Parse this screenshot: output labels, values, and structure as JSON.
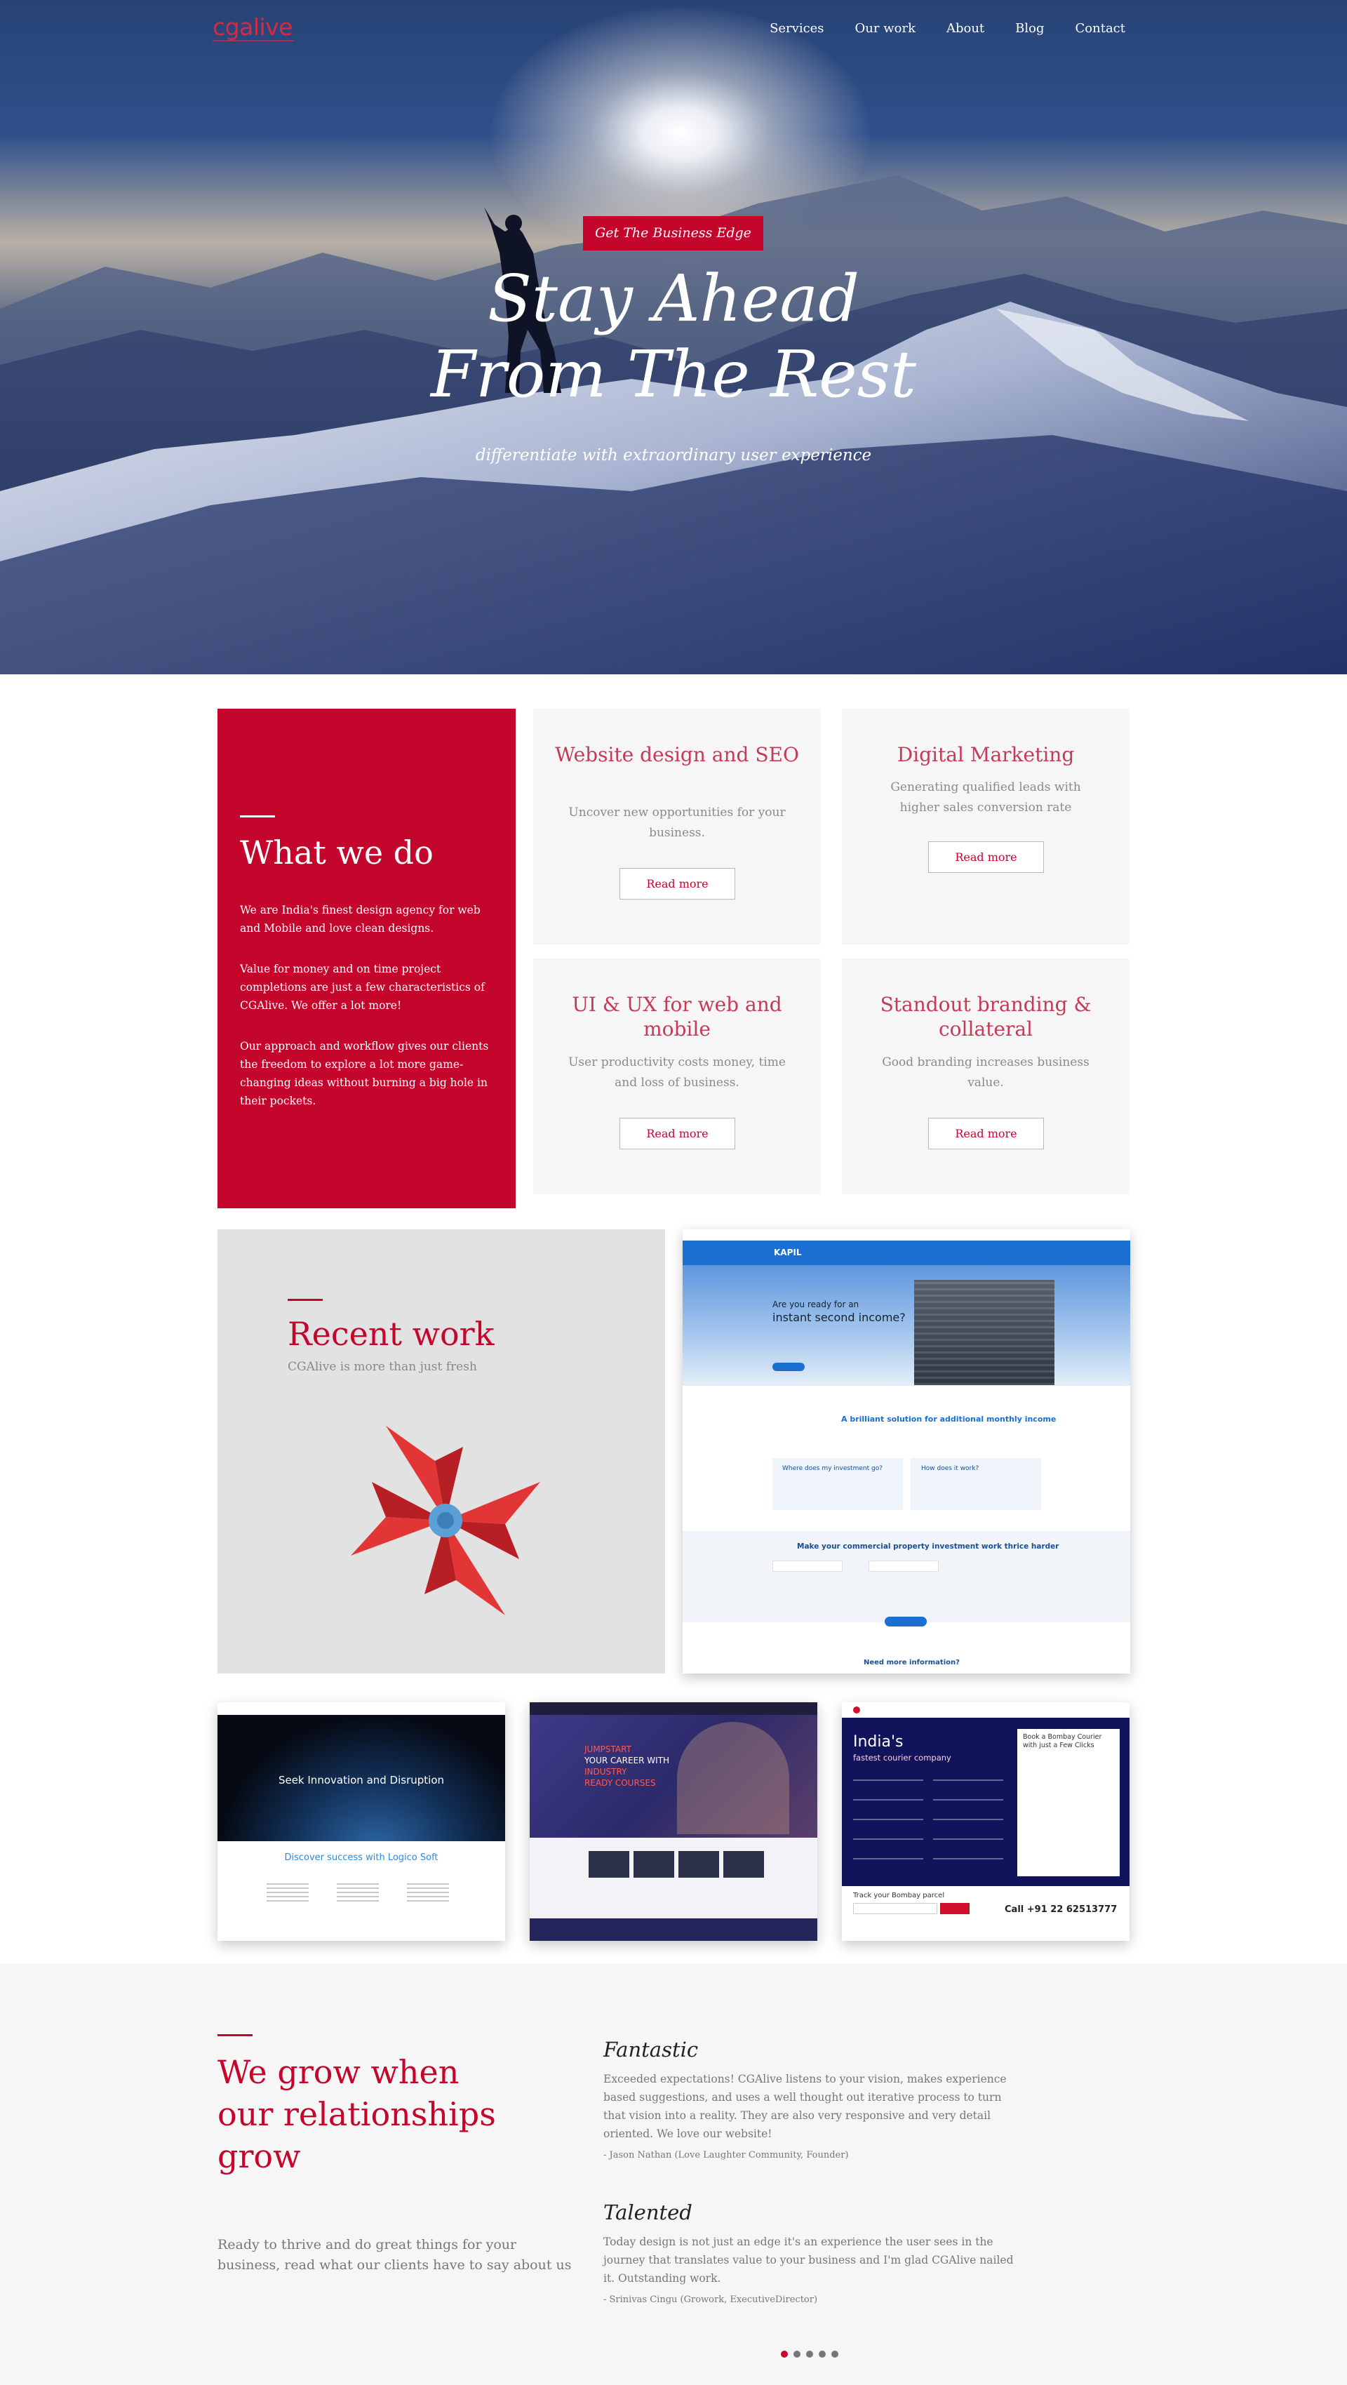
{
  "header": {
    "logo": "cgalive",
    "nav": [
      "Services",
      "Our work",
      "About",
      "Blog",
      "Contact"
    ]
  },
  "hero": {
    "badge": "Get The Business Edge",
    "headline_line1": "Stay Ahead",
    "headline_line2": "From The Rest",
    "subline": "differentiate with extraordinary user experience"
  },
  "what_we_do": {
    "title": "What we do",
    "paragraphs": [
      "We are India's finest design agency for web and Mobile and love clean designs.",
      "Value for money and on time project completions are just a few characteristics of CGAlive. We offer a lot more!",
      "Our approach and workflow gives our clients the freedom to explore a lot more game-changing ideas without burning a big hole in their pockets."
    ]
  },
  "services": [
    {
      "title": "Website design and SEO",
      "text": "Uncover new opportunities for your business.",
      "button": "Read more"
    },
    {
      "title": "Digital Marketing",
      "text": "Generating qualified leads with higher sales conversion rate",
      "button": "Read more"
    },
    {
      "title": "UI & UX for web and mobile",
      "text": "User productivity costs money, time and loss of business.",
      "button": "Read more"
    },
    {
      "title": "Standout branding & collateral",
      "text": "Good branding increases business value.",
      "button": "Read more"
    }
  ],
  "recent_work": {
    "title": "Recent work",
    "subtitle": "CGAlive is more than just fresh",
    "kapil": {
      "brand": "KAPIL",
      "q1": "Are you ready for an",
      "q2": "instant second income?",
      "solution": "A brilliant solution for additional monthly income",
      "card1": "Where does my investment go?",
      "card2": "How does it work?",
      "commercial": "Make your commercial property investment work thrice harder",
      "more": "Need more information?"
    },
    "logico": {
      "hero": "Seek Innovation and Disruption",
      "discover": "Discover success with Logico Soft"
    },
    "jump": {
      "line1": "JUMPSTART",
      "line2": "YOUR CAREER WITH",
      "line3": "INDUSTRY",
      "line4": "READY COURSES"
    },
    "courier": {
      "title": "India's",
      "subtitle": "fastest courier company",
      "book": "Book a Bombay Courier with just a Few Clicks",
      "track": "Track your Bombay parcel",
      "call": "Call +91 22 62513777"
    }
  },
  "testimonials": {
    "title": "We grow when our relationships grow",
    "intro": "Ready to thrive and do great things for your business, read what our clients have to say about us",
    "quotes": [
      {
        "heading": "Fantastic",
        "text": "Exceeded expectations! CGAlive listens to your vision, makes experience based suggestions, and uses a well thought out iterative process to turn that vision into a reality. They are also very responsive and very detail oriented. We love our website!",
        "author": "- Jason Nathan (Love Laughter Community, Founder)"
      },
      {
        "heading": "Talented",
        "text": "Today design is not just an edge it's an experience the user sees in the journey that translates value to your business and I'm glad CGAlive nailed it. Outstanding work.",
        "author": "- Srinivas Cingu (Growork, ExecutiveDirector)"
      }
    ],
    "active_slide": 1,
    "slide_count": 5
  },
  "colors": {
    "brand": "#c4052c",
    "panel": "#f6f6f6"
  }
}
